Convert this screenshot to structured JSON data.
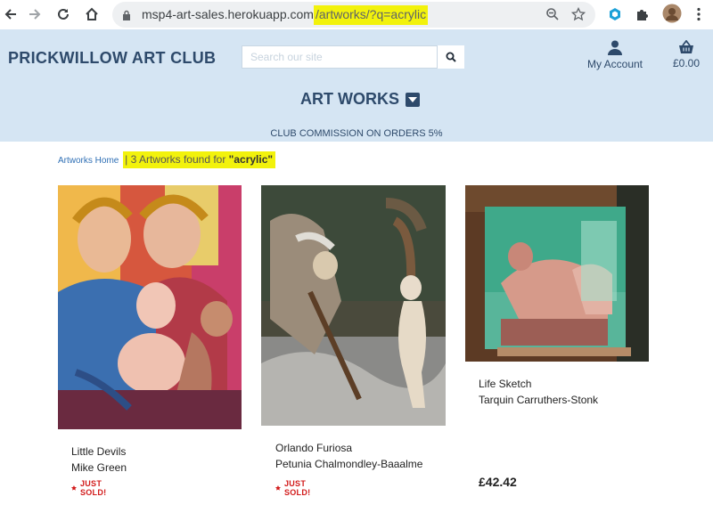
{
  "browser": {
    "url_host": "msp4-art-sales.herokuapp.com",
    "url_path": "/artworks/?q=acrylic"
  },
  "site": {
    "brand": "PRICKWILLOW ART CLUB",
    "search_placeholder": "Search our site",
    "account_label": "My Account",
    "cart_total": "£0.00",
    "section_title": "ART WORKS",
    "commission_note": "CLUB COMMISSION ON ORDERS 5%"
  },
  "breadcrumb": {
    "home": "Artworks Home",
    "separator": "|",
    "result_prefix": "3 Artworks found for",
    "query": "\"acrylic\""
  },
  "artworks": [
    {
      "title": "Little Devils",
      "artist": "Mike Green",
      "status": "JUST SOLD!",
      "price": ""
    },
    {
      "title": "Orlando Furiosa",
      "artist": "Petunia Chalmondley-Baaalme",
      "status": "JUST SOLD!",
      "price": ""
    },
    {
      "title": "Life Sketch",
      "artist": "Tarquin Carruthers-Stonk",
      "status": "",
      "price": "£42.42"
    }
  ],
  "colors": {
    "header_bg": "#d5e5f3",
    "brand_navy": "#2e4a6b",
    "sold_red": "#d21a1a",
    "highlight": "#f2f20c"
  }
}
